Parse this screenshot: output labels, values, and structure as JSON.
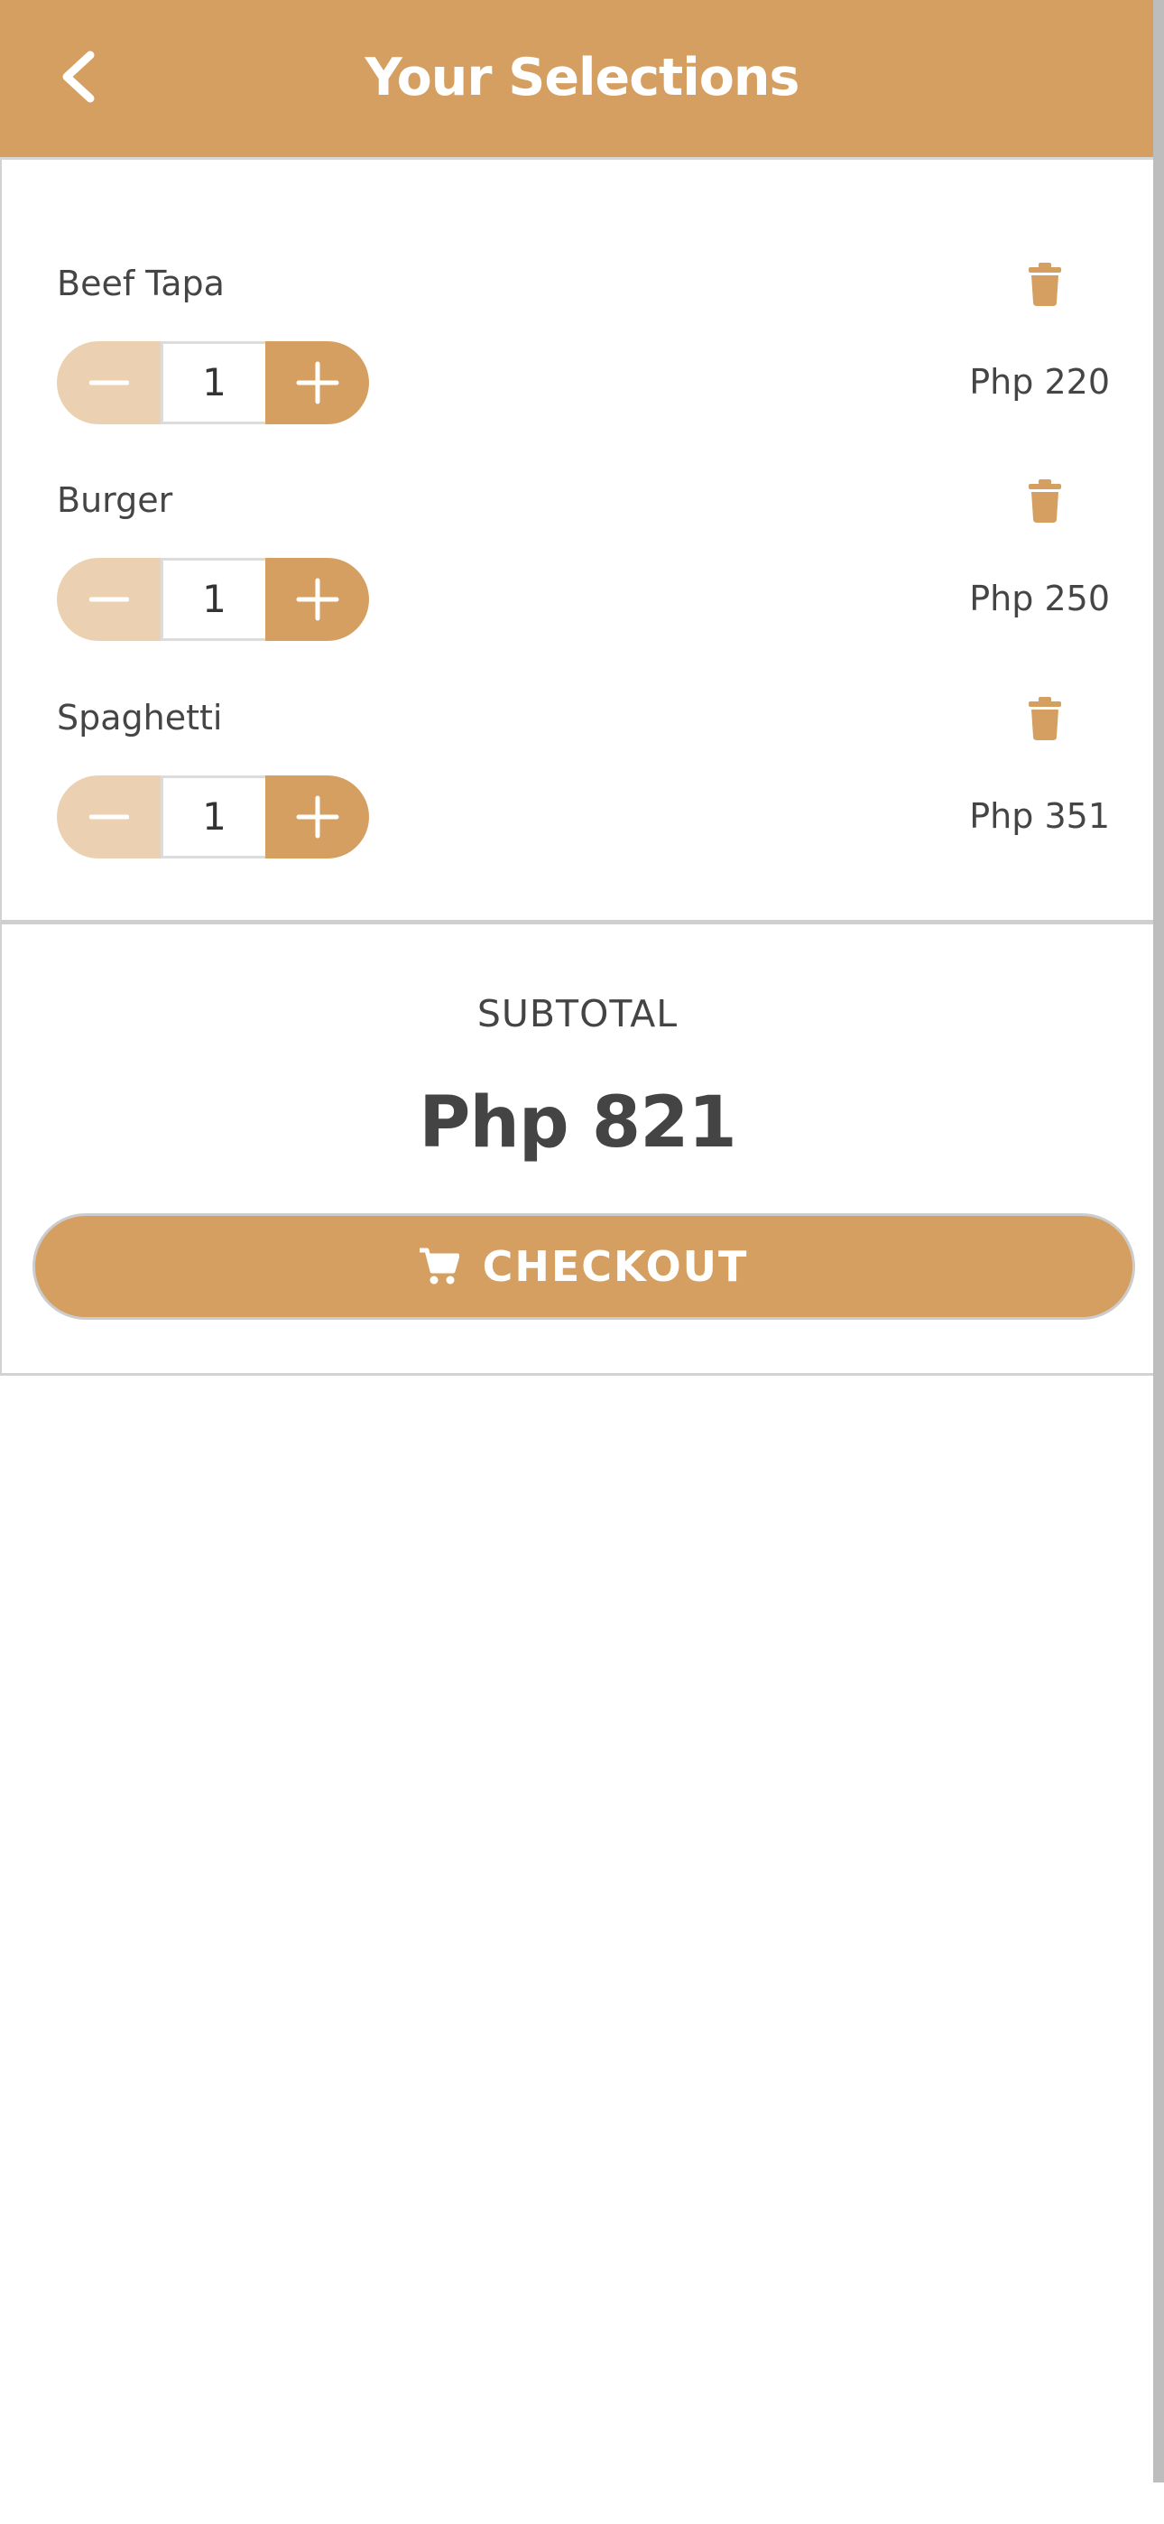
{
  "header": {
    "title": "Your Selections",
    "back_icon": "chevron-left-icon"
  },
  "cart": {
    "items": [
      {
        "name": "Beef Tapa",
        "quantity": "1",
        "price": "Php 220"
      },
      {
        "name": "Burger",
        "quantity": "1",
        "price": "Php 250"
      },
      {
        "name": "Spaghetti",
        "quantity": "1",
        "price": "Php 351"
      }
    ]
  },
  "summary": {
    "subtotal_label": "SUBTOTAL",
    "subtotal_value": "Php 821",
    "checkout_label": "CHECKOUT",
    "checkout_icon": "cart-icon"
  },
  "colors": {
    "accent": "#D59F61",
    "accent_light": "#EBD1B1",
    "text": "#444444"
  }
}
